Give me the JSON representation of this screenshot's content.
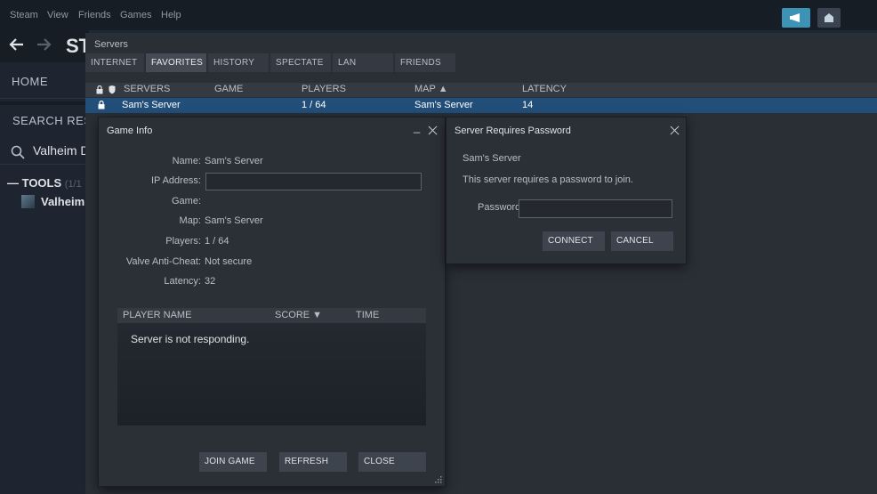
{
  "menu": {
    "steam": "Steam",
    "view": "View",
    "friends": "Friends",
    "games": "Games",
    "help": "Help"
  },
  "nav": {
    "store_partial": "ST"
  },
  "left_panel": {
    "home": "HOME",
    "search_results": "SEARCH RESU",
    "search_value": "Valheim D",
    "tools_label": "— TOOLS",
    "tools_count": "(1/1",
    "game_name": "Valheim"
  },
  "servers": {
    "title": "Servers",
    "tabs": [
      {
        "label": "INTERNET"
      },
      {
        "label": "FAVORITES"
      },
      {
        "label": "HISTORY"
      },
      {
        "label": "SPECTATE"
      },
      {
        "label": "LAN"
      },
      {
        "label": "FRIENDS"
      }
    ],
    "columns": {
      "servers": "SERVERS",
      "game": "GAME",
      "players": "PLAYERS",
      "map": "MAP ▲",
      "latency": "LATENCY"
    },
    "row": {
      "name": "Sam's Server",
      "game": "",
      "players": "1 / 64",
      "map": "Sam's Server",
      "latency": "14"
    }
  },
  "game_info": {
    "title": "Game Info",
    "minimize": "_",
    "labels": {
      "name": "Name:",
      "ip": "IP Address:",
      "game": "Game:",
      "map": "Map:",
      "players": "Players:",
      "vac": "Valve Anti-Cheat:",
      "latency": "Latency:"
    },
    "values": {
      "name": "Sam's Server",
      "ip": "",
      "game": "",
      "map": "Sam's Server",
      "players": "1 / 64",
      "vac": "Not secure",
      "latency": "32"
    },
    "table": {
      "player_name": "PLAYER NAME",
      "score": "SCORE ▼",
      "time": "TIME"
    },
    "message": "Server is not responding.",
    "buttons": {
      "join": "JOIN GAME",
      "refresh": "REFRESH",
      "close": "CLOSE"
    }
  },
  "password_dialog": {
    "title": "Server Requires Password",
    "server_name": "Sam's Server",
    "message": "This server requires a password to join.",
    "password_label": "Password",
    "password_value": "",
    "buttons": {
      "connect": "CONNECT",
      "cancel": "CANCEL"
    }
  },
  "colors": {
    "selected_row": "#224e7a",
    "accent": "#3d93b5"
  }
}
